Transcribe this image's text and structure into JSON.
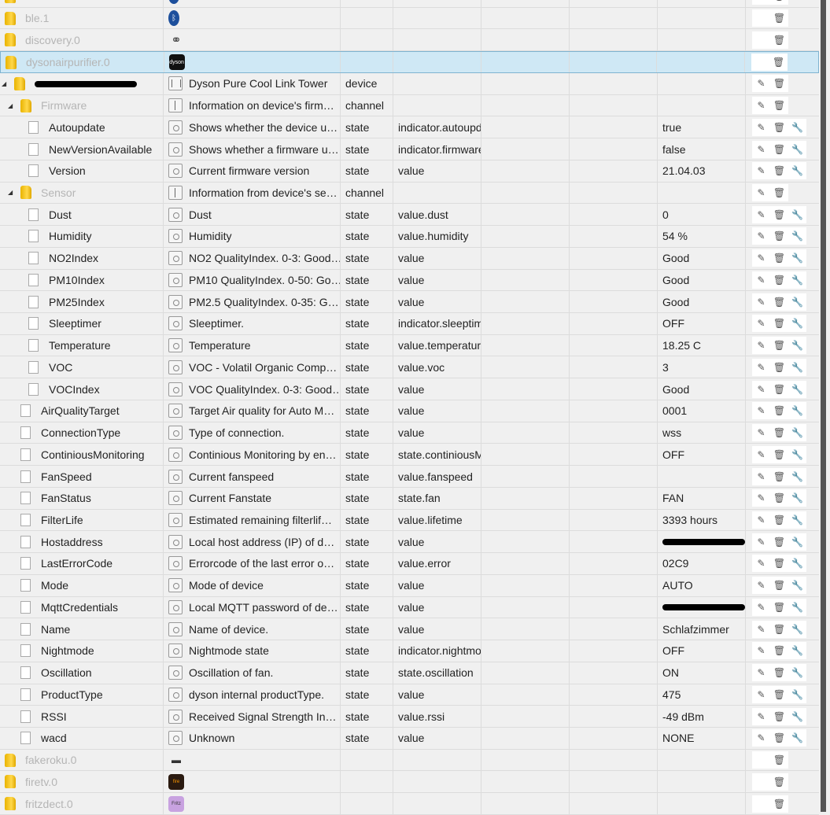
{
  "colors": {
    "selected_row": "#cfe8f5",
    "folder": "#f5c400",
    "scrollbar": "#555555"
  },
  "rows": [
    {
      "kind": "adapter",
      "name": "",
      "icon": "info",
      "actions": [
        "delete"
      ]
    },
    {
      "kind": "adapter",
      "name": "ble.1",
      "icon": "bluetooth",
      "actions": [
        "delete"
      ]
    },
    {
      "kind": "adapter",
      "name": "discovery.0",
      "icon": "binoculars",
      "actions": [
        "delete"
      ]
    },
    {
      "kind": "adapter",
      "name": "dysonairpurifier.0",
      "icon": "dyson-logo",
      "actions": [
        "delete"
      ],
      "selected": true
    },
    {
      "kind": "device",
      "level": 0,
      "name": "[redacted]",
      "redacted": true,
      "desc": "Dyson Pure Cool Link Tower",
      "type": "device",
      "actions": [
        "edit",
        "delete"
      ]
    },
    {
      "kind": "channel",
      "level": 1,
      "name": "Firmware",
      "desc": "Information on device's firm…",
      "type": "channel",
      "actions": [
        "edit",
        "delete"
      ]
    },
    {
      "kind": "state",
      "level": 2,
      "name": "Autoupdate",
      "desc": "Shows whether the device u…",
      "type": "state",
      "role": "indicator.autoupdate",
      "value": "true",
      "actions": [
        "edit",
        "delete",
        "config"
      ]
    },
    {
      "kind": "state",
      "level": 2,
      "name": "NewVersionAvailable",
      "desc": "Shows whether a firmware u…",
      "type": "state",
      "role": "indicator.firmwareupdate",
      "value": "false",
      "actions": [
        "edit",
        "delete",
        "config"
      ]
    },
    {
      "kind": "state",
      "level": 2,
      "name": "Version",
      "desc": "Current firmware version",
      "type": "state",
      "role": "value",
      "value": "21.04.03",
      "actions": [
        "edit",
        "delete",
        "config"
      ]
    },
    {
      "kind": "channel",
      "level": 1,
      "name": "Sensor",
      "desc": "Information from device's se…",
      "type": "channel",
      "actions": [
        "edit",
        "delete"
      ]
    },
    {
      "kind": "state",
      "level": 2,
      "name": "Dust",
      "desc": "Dust",
      "type": "state",
      "role": "value.dust",
      "value": "0",
      "actions": [
        "edit",
        "delete",
        "config"
      ]
    },
    {
      "kind": "state",
      "level": 2,
      "name": "Humidity",
      "desc": "Humidity",
      "type": "state",
      "role": "value.humidity",
      "value": "54 %",
      "actions": [
        "edit",
        "delete",
        "config"
      ]
    },
    {
      "kind": "state",
      "level": 2,
      "name": "NO2Index",
      "desc": "NO2 QualityIndex. 0-3: Good…",
      "type": "state",
      "role": "value",
      "value": "Good",
      "actions": [
        "edit",
        "delete",
        "config"
      ]
    },
    {
      "kind": "state",
      "level": 2,
      "name": "PM10Index",
      "desc": "PM10 QualityIndex. 0-50: Go…",
      "type": "state",
      "role": "value",
      "value": "Good",
      "actions": [
        "edit",
        "delete",
        "config"
      ]
    },
    {
      "kind": "state",
      "level": 2,
      "name": "PM25Index",
      "desc": "PM2.5 QualityIndex. 0-35: G…",
      "type": "state",
      "role": "value",
      "value": "Good",
      "actions": [
        "edit",
        "delete",
        "config"
      ]
    },
    {
      "kind": "state",
      "level": 2,
      "name": "Sleeptimer",
      "desc": "Sleeptimer.",
      "type": "state",
      "role": "indicator.sleeptimer",
      "value": "OFF",
      "actions": [
        "edit",
        "delete",
        "config"
      ]
    },
    {
      "kind": "state",
      "level": 2,
      "name": "Temperature",
      "desc": "Temperature",
      "type": "state",
      "role": "value.temperature",
      "value": "18.25 C",
      "actions": [
        "edit",
        "delete",
        "config"
      ]
    },
    {
      "kind": "state",
      "level": 2,
      "name": "VOC",
      "desc": "VOC - Volatil Organic Comp…",
      "type": "state",
      "role": "value.voc",
      "value": "3",
      "actions": [
        "edit",
        "delete",
        "config"
      ]
    },
    {
      "kind": "state",
      "level": 2,
      "name": "VOCIndex",
      "desc": "VOC QualityIndex. 0-3: Good…",
      "type": "state",
      "role": "value",
      "value": "Good",
      "actions": [
        "edit",
        "delete",
        "config"
      ]
    },
    {
      "kind": "state",
      "level": 1,
      "name": "AirQualityTarget",
      "desc": "Target Air quality for Auto M…",
      "type": "state",
      "role": "value",
      "value": "0001",
      "actions": [
        "edit",
        "delete",
        "config"
      ]
    },
    {
      "kind": "state",
      "level": 1,
      "name": "ConnectionType",
      "desc": "Type of connection.",
      "type": "state",
      "role": "value",
      "value": "wss",
      "actions": [
        "edit",
        "delete",
        "config"
      ]
    },
    {
      "kind": "state",
      "level": 1,
      "name": "ContiniousMonitoring",
      "desc": "Continious Monitoring by en…",
      "type": "state",
      "role": "state.continiousMonitoring",
      "value": "OFF",
      "actions": [
        "edit",
        "delete",
        "config"
      ]
    },
    {
      "kind": "state",
      "level": 1,
      "name": "FanSpeed",
      "desc": "Current fanspeed",
      "type": "state",
      "role": "value.fanspeed",
      "value": "",
      "actions": [
        "edit",
        "delete",
        "config"
      ]
    },
    {
      "kind": "state",
      "level": 1,
      "name": "FanStatus",
      "desc": "Current Fanstate",
      "type": "state",
      "role": "state.fan",
      "value": "FAN",
      "actions": [
        "edit",
        "delete",
        "config"
      ]
    },
    {
      "kind": "state",
      "level": 1,
      "name": "FilterLife",
      "desc": "Estimated remaining filterlif…",
      "type": "state",
      "role": "value.lifetime",
      "value": "3393 hours",
      "actions": [
        "edit",
        "delete",
        "config"
      ]
    },
    {
      "kind": "state",
      "level": 1,
      "name": "Hostaddress",
      "desc": "Local host address (IP) of d…",
      "type": "state",
      "role": "value",
      "value": "[redacted]",
      "redacted": true,
      "actions": [
        "edit",
        "delete",
        "config"
      ]
    },
    {
      "kind": "state",
      "level": 1,
      "name": "LastErrorCode",
      "desc": "Errorcode of the last error o…",
      "type": "state",
      "role": "value.error",
      "value": "02C9",
      "actions": [
        "edit",
        "delete",
        "config"
      ]
    },
    {
      "kind": "state",
      "level": 1,
      "name": "Mode",
      "desc": "Mode of device",
      "type": "state",
      "role": "value",
      "value": "AUTO",
      "actions": [
        "edit",
        "delete",
        "config"
      ]
    },
    {
      "kind": "state",
      "level": 1,
      "name": "MqttCredentials",
      "desc": "Local MQTT password of de…",
      "type": "state",
      "role": "value",
      "value": "[redacted]",
      "redacted": true,
      "actions": [
        "edit",
        "delete",
        "config"
      ]
    },
    {
      "kind": "state",
      "level": 1,
      "name": "Name",
      "desc": "Name of device.",
      "type": "state",
      "role": "value",
      "value": "Schlafzimmer",
      "actions": [
        "edit",
        "delete",
        "config"
      ]
    },
    {
      "kind": "state",
      "level": 1,
      "name": "Nightmode",
      "desc": "Nightmode state",
      "type": "state",
      "role": "indicator.nightmode",
      "value": "OFF",
      "actions": [
        "edit",
        "delete",
        "config"
      ]
    },
    {
      "kind": "state",
      "level": 1,
      "name": "Oscillation",
      "desc": "Oscillation of fan.",
      "type": "state",
      "role": "state.oscillation",
      "value": "ON",
      "actions": [
        "edit",
        "delete",
        "config"
      ]
    },
    {
      "kind": "state",
      "level": 1,
      "name": "ProductType",
      "desc": "dyson internal productType.",
      "type": "state",
      "role": "value",
      "value": "475",
      "actions": [
        "edit",
        "delete",
        "config"
      ]
    },
    {
      "kind": "state",
      "level": 1,
      "name": "RSSI",
      "desc": "Received Signal Strength In…",
      "type": "state",
      "role": "value.rssi",
      "value": "-49 dBm",
      "actions": [
        "edit",
        "delete",
        "config"
      ]
    },
    {
      "kind": "state",
      "level": 1,
      "name": "wacd",
      "desc": "Unknown",
      "type": "state",
      "role": "value",
      "value": "NONE",
      "actions": [
        "edit",
        "delete",
        "config"
      ]
    },
    {
      "kind": "adapter",
      "name": "fakeroku.0",
      "icon": "fakeroku-logo",
      "actions": [
        "delete"
      ]
    },
    {
      "kind": "adapter",
      "name": "firetv.0",
      "icon": "firetv-logo",
      "actions": [
        "delete"
      ]
    },
    {
      "kind": "adapter",
      "name": "fritzdect.0",
      "icon": "fritzdect-logo",
      "actions": [
        "delete"
      ]
    }
  ]
}
